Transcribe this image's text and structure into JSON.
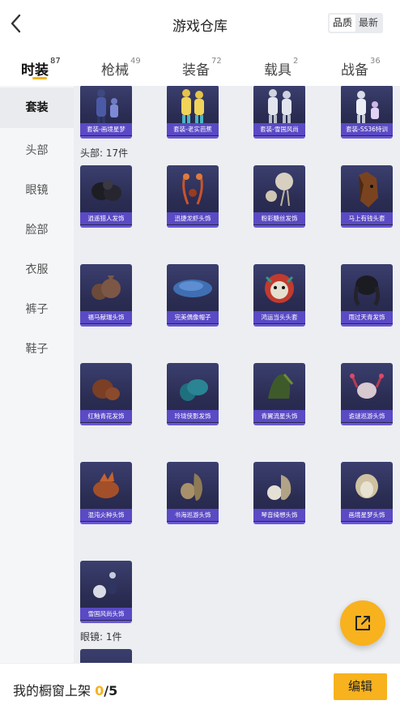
{
  "header": {
    "title": "游戏仓库",
    "sort_options": [
      "品质",
      "最新"
    ],
    "sort_selected": "品质"
  },
  "tabs": [
    {
      "label": "时装",
      "count": "87"
    },
    {
      "label": "枪械",
      "count": "49"
    },
    {
      "label": "装备",
      "count": "72"
    },
    {
      "label": "载具",
      "count": "2"
    },
    {
      "label": "战备",
      "count": "36"
    }
  ],
  "sidebar": [
    "套装",
    "头部",
    "眼镜",
    "脸部",
    "衣服",
    "裤子",
    "鞋子"
  ],
  "sets": [
    "套装-画境星梦",
    "套装-老实芭蕉",
    "套装-雪国风尚",
    "套装-SS36特训"
  ],
  "head_section": "头部: 17件",
  "head_items": [
    "逍遥猎人发饰",
    "迅捷龙虾头饰",
    "粉彩糖丝发饰",
    "马上有钱头套",
    "福马献瑞头饰",
    "完美偶像帽子",
    "鸿运当头头套",
    "雨过天青发饰",
    "红釉青花发饰",
    "玲珑侠影发饰",
    "青翼流星头饰",
    "诡谜巡游头饰",
    "混沌火种头饰",
    "书海巡游头饰",
    "琴音绮想头饰",
    "画境星梦头饰",
    "雪国风尚头饰"
  ],
  "glasses_section": "眼镜: 1件",
  "footer": {
    "label": "我的橱窗上架 ",
    "count": "0",
    "total": "/5",
    "edit": "编辑"
  },
  "colors": {
    "accent": "#f7b21e",
    "card_label": "#5a4ac4"
  },
  "icons": [
    "back-arrow-icon",
    "share-icon"
  ]
}
